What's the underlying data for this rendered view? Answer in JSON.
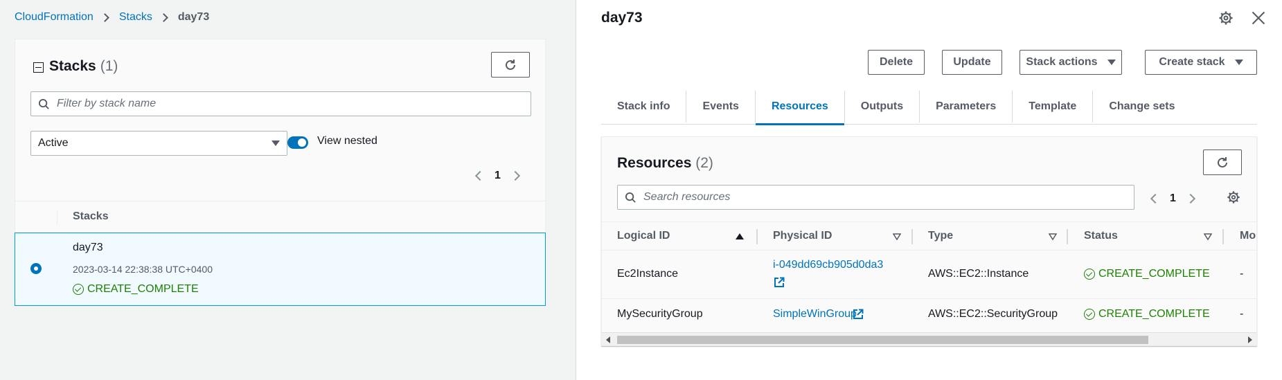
{
  "breadcrumb": {
    "items": [
      "CloudFormation",
      "Stacks"
    ],
    "current": "day73"
  },
  "stacks_panel": {
    "title": "Stacks",
    "count": "(1)",
    "search_placeholder": "Filter by stack name",
    "filter_selected": "Active",
    "view_nested_label": "View nested",
    "view_nested_on": true,
    "page": "1",
    "column_header": "Stacks",
    "rows": [
      {
        "name": "day73",
        "created": "2023-03-14 22:38:38 UTC+0400",
        "status": "CREATE_COMPLETE",
        "selected": true
      }
    ]
  },
  "detail": {
    "title": "day73",
    "buttons": {
      "delete": "Delete",
      "update": "Update",
      "stack_actions": "Stack actions",
      "create_stack": "Create stack"
    },
    "tabs": [
      "Stack info",
      "Events",
      "Resources",
      "Outputs",
      "Parameters",
      "Template",
      "Change sets"
    ],
    "active_tab": "Resources"
  },
  "resources": {
    "title": "Resources",
    "count": "(2)",
    "search_placeholder": "Search resources",
    "page": "1",
    "columns": [
      "Logical ID",
      "Physical ID",
      "Type",
      "Status",
      "Mo"
    ],
    "rows": [
      {
        "logical_id": "Ec2Instance",
        "physical_id_line1": "i-049dd69cb905d0da3",
        "type": "AWS::EC2::Instance",
        "status": "CREATE_COMPLETE",
        "module": "-"
      },
      {
        "logical_id": "MySecurityGroup",
        "physical_id": "SimpleWinGroup",
        "type": "AWS::EC2::SecurityGroup",
        "status": "CREATE_COMPLETE",
        "module": "-"
      }
    ]
  },
  "colors": {
    "link": "#0073bb",
    "success": "#1d8102",
    "selected_row_bg": "#f1faff",
    "selected_row_border": "#00a1c9"
  }
}
